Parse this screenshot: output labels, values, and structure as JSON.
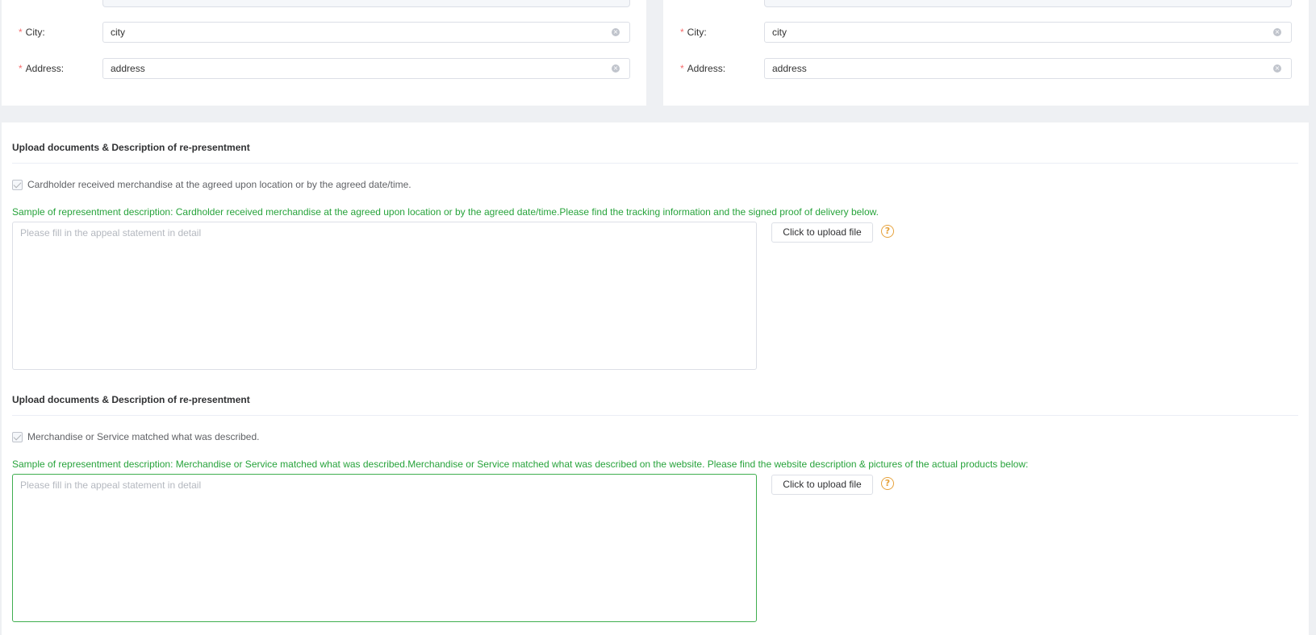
{
  "left_address": {
    "city_label": "City",
    "city_value": "city",
    "address_label": "Address",
    "address_value": "address"
  },
  "right_address": {
    "city_label": "City",
    "city_value": "city",
    "address_label": "Address",
    "address_value": "address"
  },
  "colon": ":",
  "required_mark": "*",
  "sections": [
    {
      "title": "Upload documents & Description of re-presentment",
      "checkbox_label": "Cardholder received merchandise at the agreed upon location or by the agreed date/time.",
      "sample": "Sample of representment description: Cardholder received merchandise at the agreed upon location or by the agreed date/time.Please find the tracking information and the signed proof of delivery below.",
      "placeholder": "Please fill in the appeal statement in detail",
      "upload_label": "Click to upload file",
      "help_glyph": "?"
    },
    {
      "title": "Upload documents & Description of re-presentment",
      "checkbox_label": "Merchandise or Service matched what was described.",
      "sample": "Sample of representment description: Merchandise or Service matched what was described.Merchandise or Service matched what was described on the website. Please find the website description & pictures of the actual products below:",
      "placeholder": "Please fill in the appeal statement in detail",
      "upload_label": "Click to upload file",
      "help_glyph": "?"
    }
  ],
  "colors": {
    "sample_text": "#27a33b",
    "required": "#f56c6c",
    "help_icon": "#e6a23c",
    "active_border": "#3fae4f"
  },
  "icons": {
    "clear": "clear-icon",
    "help": "question-circle-icon",
    "check": "checkbox-checked-icon"
  }
}
